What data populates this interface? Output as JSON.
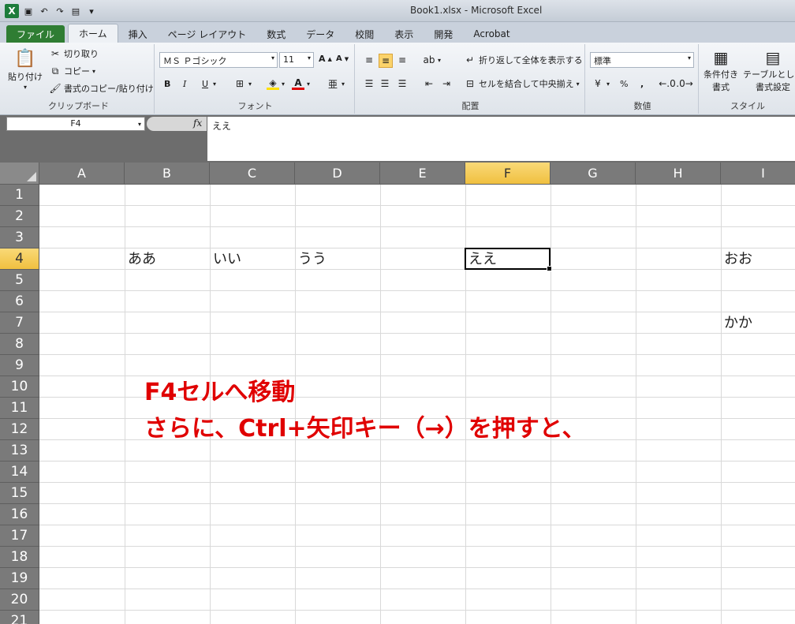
{
  "window": {
    "title": "Book1.xlsx - Microsoft Excel"
  },
  "tabs": [
    {
      "label": "ファイル"
    },
    {
      "label": "ホーム"
    },
    {
      "label": "挿入"
    },
    {
      "label": "ページ レイアウト"
    },
    {
      "label": "数式"
    },
    {
      "label": "データ"
    },
    {
      "label": "校閲"
    },
    {
      "label": "表示"
    },
    {
      "label": "開発"
    },
    {
      "label": "Acrobat"
    }
  ],
  "ribbon": {
    "clipboard": {
      "paste": "貼り付け",
      "cut": "切り取り",
      "copy": "コピー",
      "format_painter": "書式のコピー/貼り付け",
      "label": "クリップボード"
    },
    "font": {
      "name": "ＭＳ Ｐゴシック",
      "size": "11",
      "bold": "B",
      "italic": "I",
      "underline": "U",
      "label": "フォント"
    },
    "alignment": {
      "wrap_text": "折り返して全体を表示する",
      "merge_center": "セルを結合して中央揃え",
      "label": "配置"
    },
    "number": {
      "format": "標準",
      "percent": "%",
      "comma": ",",
      "label": "数値"
    },
    "styles": {
      "conditional": "条件付き",
      "conditional2": "書式",
      "table": "テーブルとして",
      "table2": "書式設定",
      "label": "スタイル"
    }
  },
  "formula_bar": {
    "name_box": "F4",
    "fx": "fx",
    "content": "ええ"
  },
  "columns": [
    "A",
    "B",
    "C",
    "D",
    "E",
    "F",
    "G",
    "H",
    "I"
  ],
  "rows": [
    "1",
    "2",
    "3",
    "4",
    "5",
    "6",
    "7",
    "8",
    "9",
    "10",
    "11",
    "12",
    "13",
    "14",
    "15",
    "16",
    "17",
    "18",
    "19",
    "20",
    "21"
  ],
  "cells": {
    "B4": "ああ",
    "C4": "いい",
    "D4": "うう",
    "F4": "ええ",
    "I4": "おお",
    "I7": "かか"
  },
  "selected": {
    "column": "F",
    "row": "4"
  },
  "annotation": {
    "line1": "F4セルへ移動",
    "line2": "さらに、Ctrl+矢印キー（→）を押すと、",
    "color": "#e00000"
  }
}
